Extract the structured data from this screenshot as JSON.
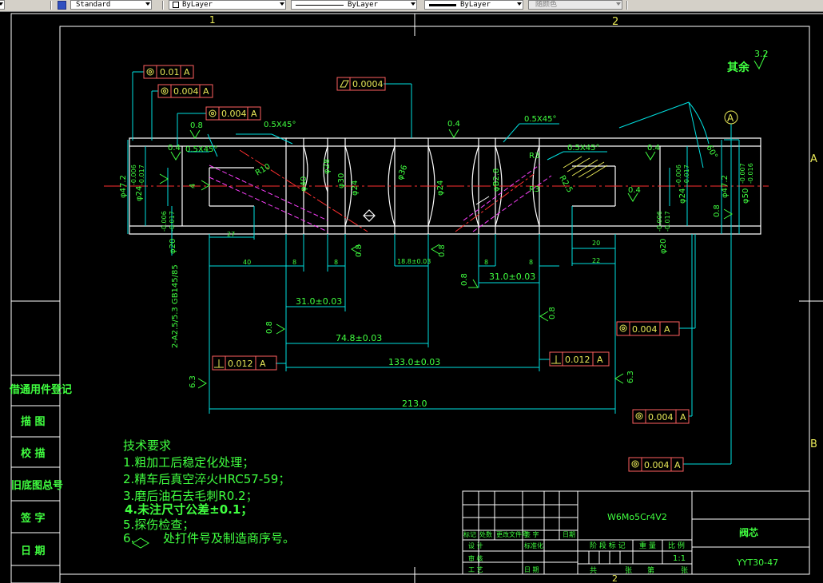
{
  "toolbar": {
    "textstyle": "Standard",
    "layer": "ByLayer",
    "linetype": "ByLayer",
    "lineweight": "ByLayer",
    "plotstyle": "随颜色"
  },
  "zones": {
    "top1": "1",
    "top2": "2",
    "right_a": "A",
    "right_b": "B",
    "bottom2": "2"
  },
  "roughness": {
    "other_label": "其余",
    "other_value": "3.2",
    "r08": "0.8",
    "r04": "0.4",
    "r63": "6.3"
  },
  "gdt": {
    "f1": {
      "value": "0.01",
      "ref": "A"
    },
    "f2": {
      "value": "0.004",
      "ref": "A"
    },
    "f3": {
      "value": "0.004",
      "ref": "A"
    },
    "f4": {
      "value": "0.0004"
    },
    "f5": {
      "value": "0.004",
      "ref": "A"
    },
    "f6": {
      "value": "0.012",
      "ref": "A"
    },
    "f7": {
      "value": "0.012",
      "ref": "A"
    },
    "f8": {
      "value": "0.004",
      "ref": "A"
    },
    "f9": {
      "value": "0.004",
      "ref": "A"
    },
    "datum": "A"
  },
  "dims": {
    "chamfer1": "0.5X45°",
    "chamfer2": "0.5X45°",
    "chamfer3": "0.5X45°",
    "chamfer4": "0.5X45°",
    "d_31a": "31.0±0.03",
    "d_31b": "31.0±0.03",
    "d_748": "74.8±0.03",
    "d_133": "133.0±0.03",
    "d_213": "213.0",
    "d_40": "40",
    "d_8a": "8",
    "d_8b": "8",
    "d_8c": "8",
    "d_8d": "8",
    "d_18": "18.8±0.03",
    "d_20": "20",
    "d_22": "22",
    "d_27": "27",
    "dia_472l": "φ47.2",
    "dia_24l": "φ24",
    "tol_24l_u": "-0.006",
    "tol_24l_l": "-0.017",
    "dia_20l": "φ20",
    "tol_20l_u": "-0.006",
    "tol_20l_l": "-0.017",
    "dia_472r": "φ47.2",
    "dia_24r": "φ24",
    "tol_24r_u": "-0.006",
    "tol_24r_l": "-0.017",
    "dia_20r": "φ20",
    "tol_20r_u": "-0.006",
    "tol_20r_l": "-0.017",
    "dia_50": "φ50",
    "tol_50_u": "-0.007",
    "tol_50_l": "-0.016",
    "dia_40": "φ40",
    "dia_28": "φ28",
    "dia_24a": "φ24",
    "dia_24b": "φ24",
    "dia_30": "φ30",
    "dia_36": "φ36",
    "dia_28b": "φB2.8",
    "r10": "R10",
    "r3a": "R3",
    "r3b": "R3",
    "r3c": "R3",
    "r25": "R2.5",
    "ang": "60°",
    "center_hole": "2-A2.5/5.3 GB145/85",
    "sq": "4"
  },
  "tech": {
    "title": "技术要求",
    "l1": "1.粗加工后稳定化处理；",
    "l2": "2.精车后真空淬火HRC57-59；",
    "l3": "3.磨后油石去毛刺R0.2；",
    "l4": "4.未注尺寸公差±0.1；",
    "l5": "5.探伤检查；",
    "l6": "6.",
    "l6b": "处打件号及制造商序号。"
  },
  "side": {
    "s1": "借通用件登记",
    "s2": "描 图",
    "s3": "校 描",
    "s4": "旧底图总号",
    "s5": "签 字",
    "s6": "日 期"
  },
  "title_block": {
    "material": "W6Mo5Cr4V2",
    "name": "阀芯",
    "code": "YYT30-47",
    "scale": "1:1",
    "h_mark": "标记",
    "h_count": "处数",
    "h_file": "更改文件号",
    "h_sign": "签 字",
    "h_date": "日期",
    "design": "设 计",
    "std": "标准化",
    "review": "审 核",
    "process": "工 艺",
    "approve": "日 期",
    "stage": "阶 段 标 记",
    "weight": "重 量",
    "ratio": "比 例",
    "total": "共",
    "sheet": "张",
    "page_no": "第",
    "page_sheet": "张"
  }
}
